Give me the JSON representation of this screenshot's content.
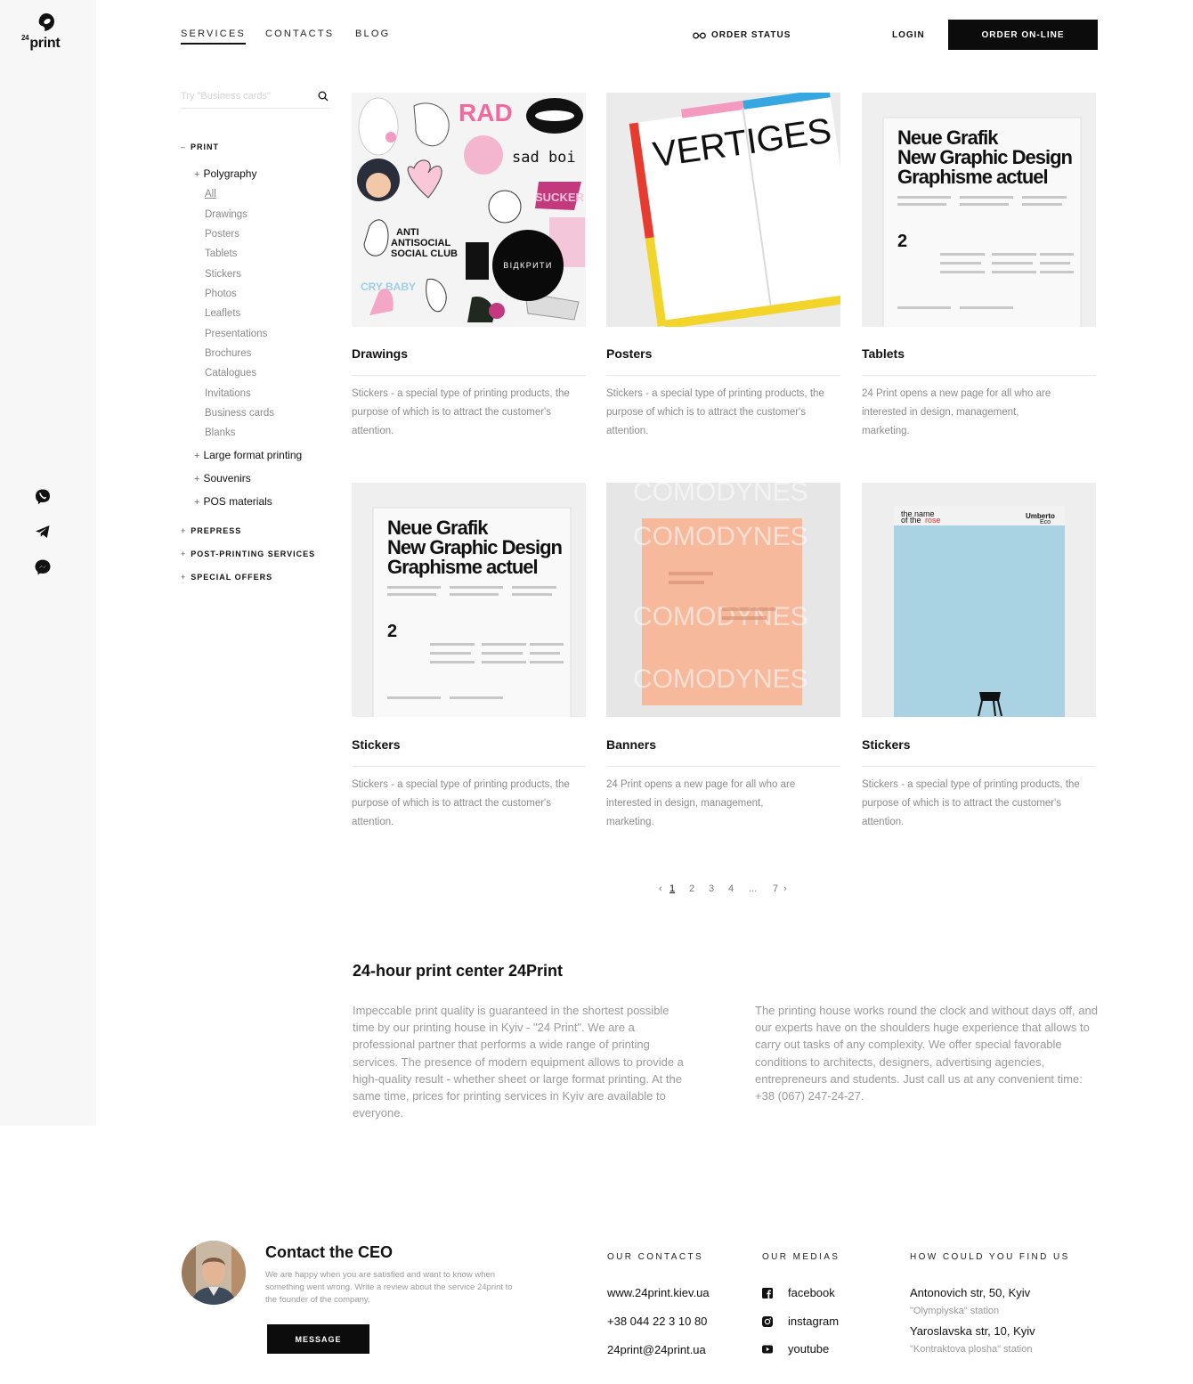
{
  "brand": {
    "logo_text": "print",
    "logo_sup": "24"
  },
  "nav": {
    "services": "SERVICES",
    "contacts": "CONTACTS",
    "blog": "BLOG",
    "order_status": "ORDER STATUS",
    "login": "LOGIN",
    "order_online": "ORDER ON-LINE"
  },
  "search": {
    "placeholder": "Try \"Business cards\""
  },
  "sidebar": {
    "print": "PRINT",
    "polygraphy": "Polygraphy",
    "polygraphy_items": [
      "All",
      "Drawings",
      "Posters",
      "Tablets",
      "Stickers",
      "Photos",
      "Leaflets",
      "Presentations",
      "Brochures",
      "Catalogues",
      "Invitations",
      "Business cards",
      "Blanks"
    ],
    "large_format": "Large format printing",
    "souvenirs": "Souvenirs",
    "pos": "POS materials",
    "prepress": "PREPRESS",
    "post_printing": "POST-PRINTING SERVICES",
    "special_offers": "SPECIAL OFFERS",
    "collapse_mark": "–",
    "expand_mark": "+"
  },
  "cards": [
    {
      "title": "Drawings",
      "desc": "Stickers - a special type of printing products, the purpose of which is to attract the customer's attention.",
      "overlay": "ВІДКРИТИ"
    },
    {
      "title": "Posters",
      "desc": "Stickers - a special type of printing products, the purpose of which is to attract the customer's attention.",
      "img_text": "VERTIGES"
    },
    {
      "title": "Tablets",
      "desc": "24 Print opens a new page for all who are interested in design, management, marketing.",
      "img_text": "Neue Grafik New Graphic Design Graphisme actuel",
      "img_num": "2"
    },
    {
      "title": "Stickers",
      "desc": "Stickers - a special type of printing products, the purpose of which is to attract the customer's attention.",
      "img_text": "Neue Grafik New Graphic Design Graphisme actuel",
      "img_num": "2"
    },
    {
      "title": "Banners",
      "desc": "24 Print opens a new page for all who are interested in design, management, marketing.",
      "img_text": "COMODYNES"
    },
    {
      "title": "Stickers",
      "desc": "Stickers - a special type of printing products, the purpose of which is to attract the customer's attention.",
      "img_text": "the name of the rose",
      "img_author": "Umberto Eco"
    }
  ],
  "pagination": {
    "prev": "‹",
    "pages": [
      "1",
      "2",
      "3",
      "4",
      "...",
      "7"
    ],
    "next": "›"
  },
  "about": {
    "title": "24-hour print center 24Print",
    "col1": "Impeccable print quality is guaranteed in the shortest possible time by our printing house in Kyiv - \"24 Print\". We are a professional partner that performs a wide range of printing services. The presence of modern equipment allows to provide a high-quality result - whether sheet or large format printing. At the same time, prices for printing services in Kyiv are available to everyone.",
    "col2": "The printing house works round the clock and without days off, and our experts have on the shoulders huge experience that allows to carry out tasks of any complexity. We offer special favorable conditions to architects, designers, advertising agencies, entrepreneurs and students. Just call us at any convenient time:",
    "phone": "+38 (067) 247-24-27."
  },
  "footer": {
    "ceo_title": "Contact the CEO",
    "ceo_text": "We are happy when you are satisfied and want to know when something went wrong. Write a review about the service 24print to the founder of the company.",
    "message": "MESSAGE",
    "contacts_head": "OUR CONTACTS",
    "site": "www.24print.kiev.ua",
    "phone": "+38 044 22 3 10 80",
    "email": "24print@24print.ua",
    "medias_head": "OUR MEDIAS",
    "facebook": "facebook",
    "instagram": "instagram",
    "youtube": "youtube",
    "find_head": "HOW COULD YOU FIND US",
    "addr1": "Antonovich str, 50, Kyiv",
    "station1": "\"Olympiyska\" station",
    "addr2": "Yaroslavska str, 10, Kyiv",
    "station2": "\"Kontraktova plosha\" station"
  }
}
